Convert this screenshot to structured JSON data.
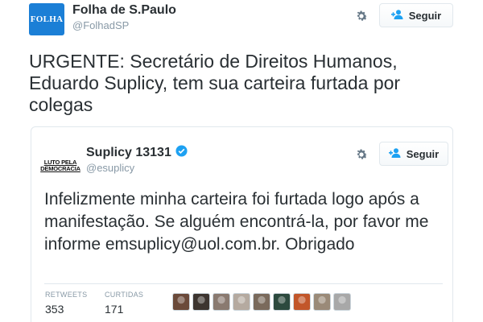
{
  "outer_tweet": {
    "avatar_text": "FOLHA",
    "name": "Folha de S.Paulo",
    "handle": "@FolhadSP",
    "follow_label": "Seguir",
    "text": "URGENTE: Secretário de Direitos Humanos, Eduardo Suplicy, tem sua carteira furtada por colegas"
  },
  "quoted_tweet": {
    "avatar_line1": "LUTO PELA",
    "avatar_line2": "DEMOCRACIA",
    "name": "Suplicy 13131",
    "verified": true,
    "handle": "@esuplicy",
    "follow_label": "Seguir",
    "text": "Infelizmente minha carteira foi furtada logo após a manifestação. Se alguém encontrá-la, por favor me informe emsuplicy@uol.com.br. Obrigado",
    "retweets_label": "RETWEETS",
    "retweets_value": "353",
    "likes_label": "CURTIDAS",
    "likes_value": "171",
    "liker_colors": [
      "#6b4a3a",
      "#3d3530",
      "#8a7a70",
      "#b5aaa0",
      "#7a6a5c",
      "#2c4a3e",
      "#c2562a",
      "#9a8a78",
      "#a8a8a8"
    ]
  },
  "colors": {
    "brand_blue": "#1b7fd6",
    "text": "#292f33",
    "muted": "#8899a6",
    "verified": "#1da1f2"
  },
  "icons": [
    "gear-icon",
    "follow-person-icon",
    "verified-badge-icon"
  ]
}
